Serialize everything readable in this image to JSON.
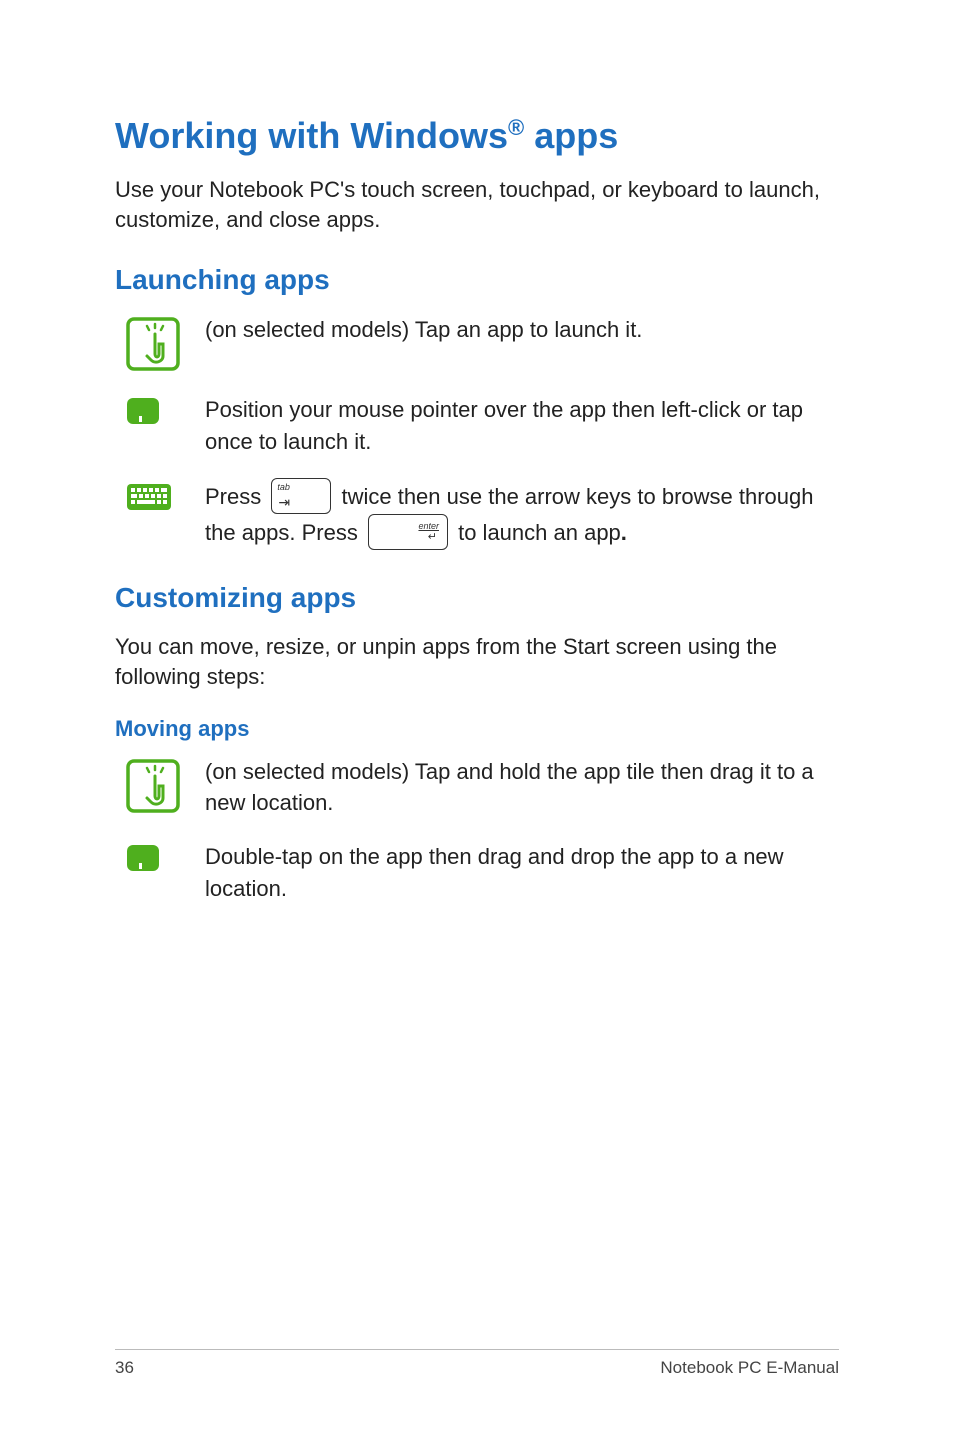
{
  "heading": {
    "prefix": "Working with Windows",
    "reg": "®",
    "suffix": " apps"
  },
  "intro": "Use your Notebook PC's touch screen, touchpad, or keyboard to launch, customize, and close apps.",
  "launching": {
    "title": "Launching apps",
    "touch": "(on selected models) Tap an app to launch it.",
    "touchpad": "Position your mouse pointer over the app then left-click or tap once to launch it.",
    "keyboard_part1": "Press ",
    "keyboard_part2": " twice then use the arrow keys to browse through the apps. Press ",
    "keyboard_part3": " to launch an app",
    "keyboard_period": "."
  },
  "customizing": {
    "title": "Customizing apps",
    "intro": "You can move, resize, or unpin apps from the Start screen using the following steps:",
    "moving_title": "Moving apps",
    "moving_touch": "(on selected models) Tap and hold the app tile then drag it to a new location.",
    "moving_touchpad": "Double-tap on the app then drag and drop the app to a new location."
  },
  "footer": {
    "page": "36",
    "manual": "Notebook PC E-Manual"
  }
}
